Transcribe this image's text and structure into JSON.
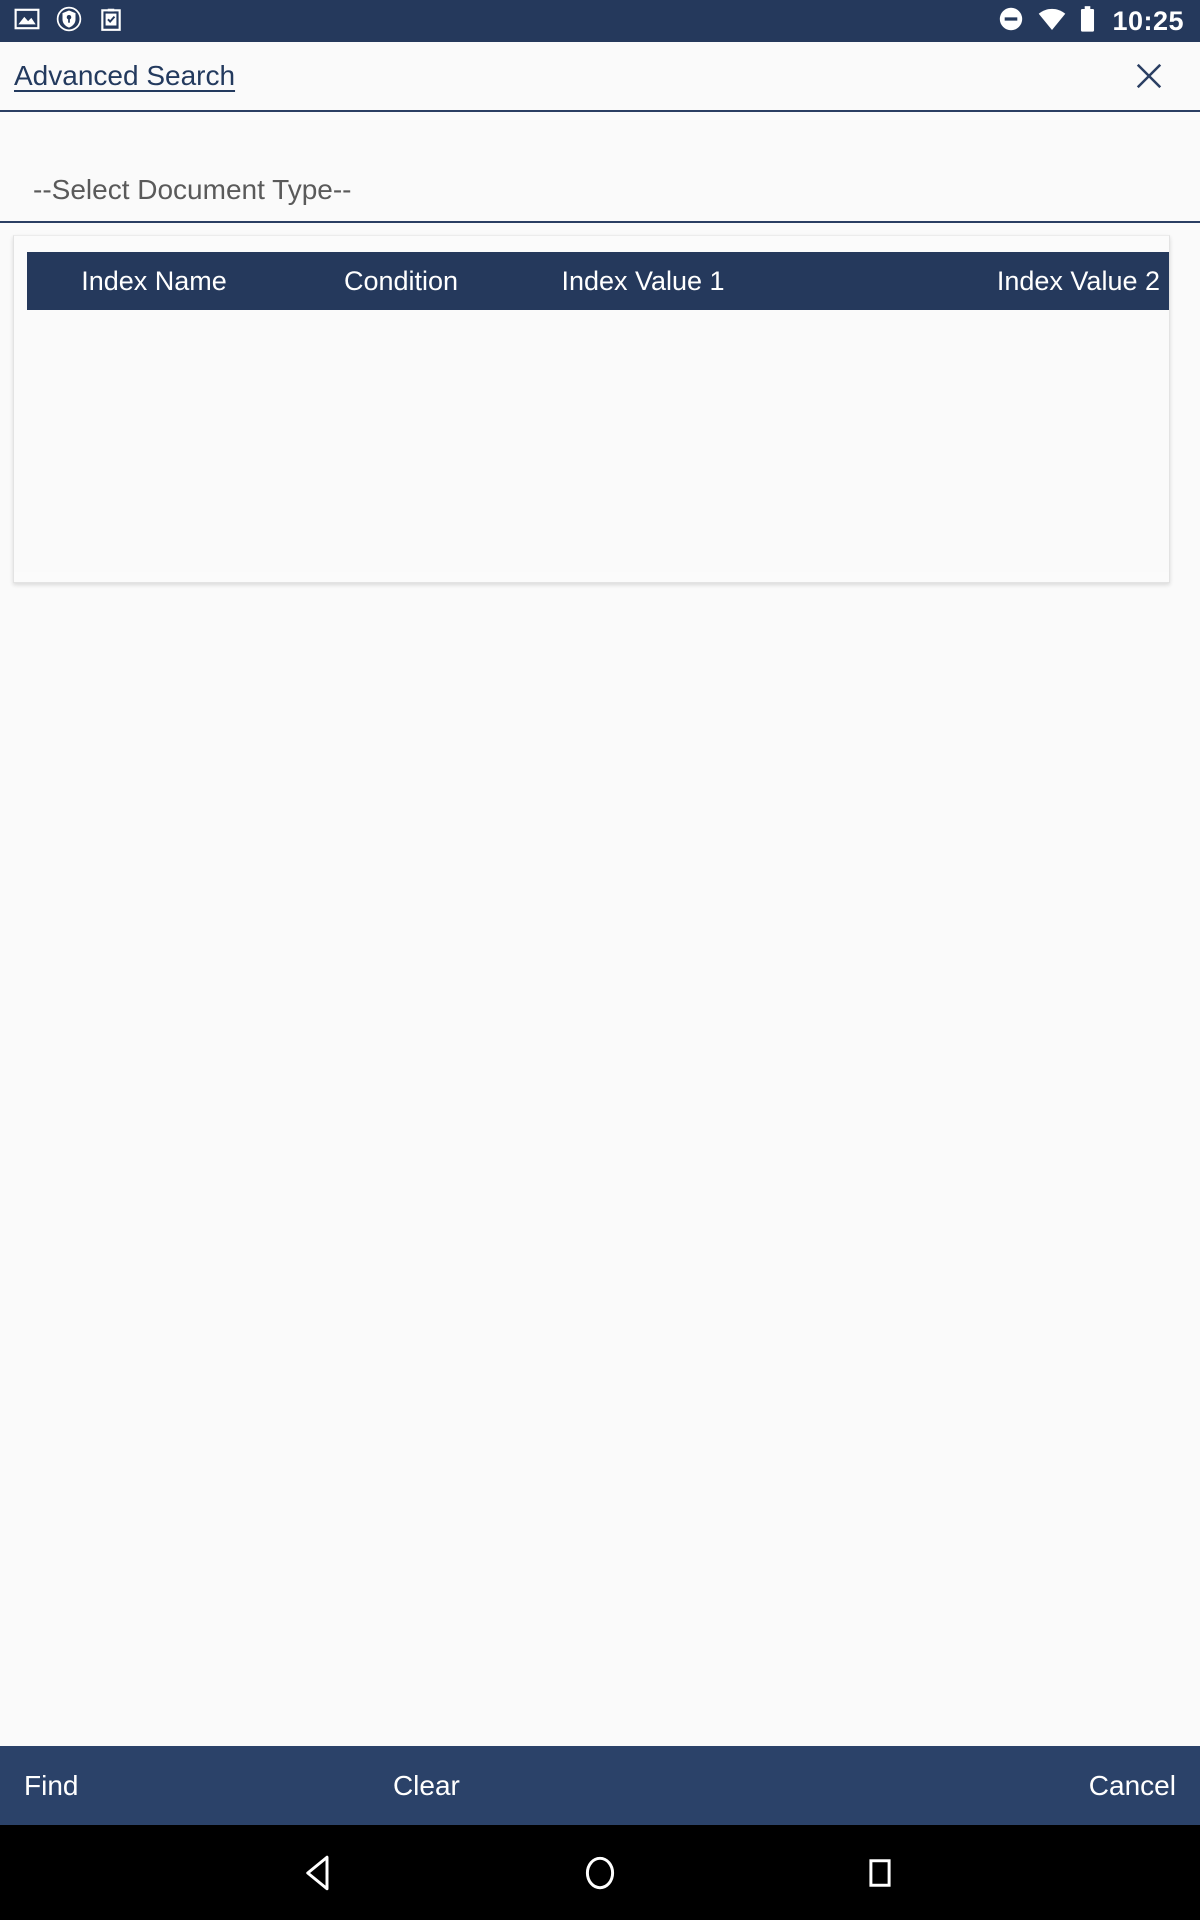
{
  "status_bar": {
    "time": "10:25",
    "left_icons": [
      "image-icon",
      "shield-location-icon",
      "clipboard-check-icon"
    ],
    "right_icons": [
      "do-not-disturb-icon",
      "wifi-icon",
      "battery-icon"
    ],
    "background_color": "#25395c"
  },
  "header": {
    "title": "Advanced Search",
    "close_icon": "close-icon"
  },
  "form": {
    "document_type": {
      "selected": "--Select Document Type--",
      "options": [
        "--Select Document Type--"
      ]
    }
  },
  "grid": {
    "columns": [
      "Index Name",
      "Condition",
      "Index Value 1",
      "Index Value 2"
    ],
    "rows": []
  },
  "actions": {
    "find": "Find",
    "clear": "Clear",
    "cancel": "Cancel"
  },
  "navigation": {
    "back": "back-icon",
    "home": "home-icon",
    "recents": "recents-icon"
  },
  "colors": {
    "status_bar": "#25395c",
    "grid_header": "#25395c",
    "action_bar": "#2b4269",
    "accent_line": "#2b3f63",
    "page_background": "#fafafa"
  }
}
